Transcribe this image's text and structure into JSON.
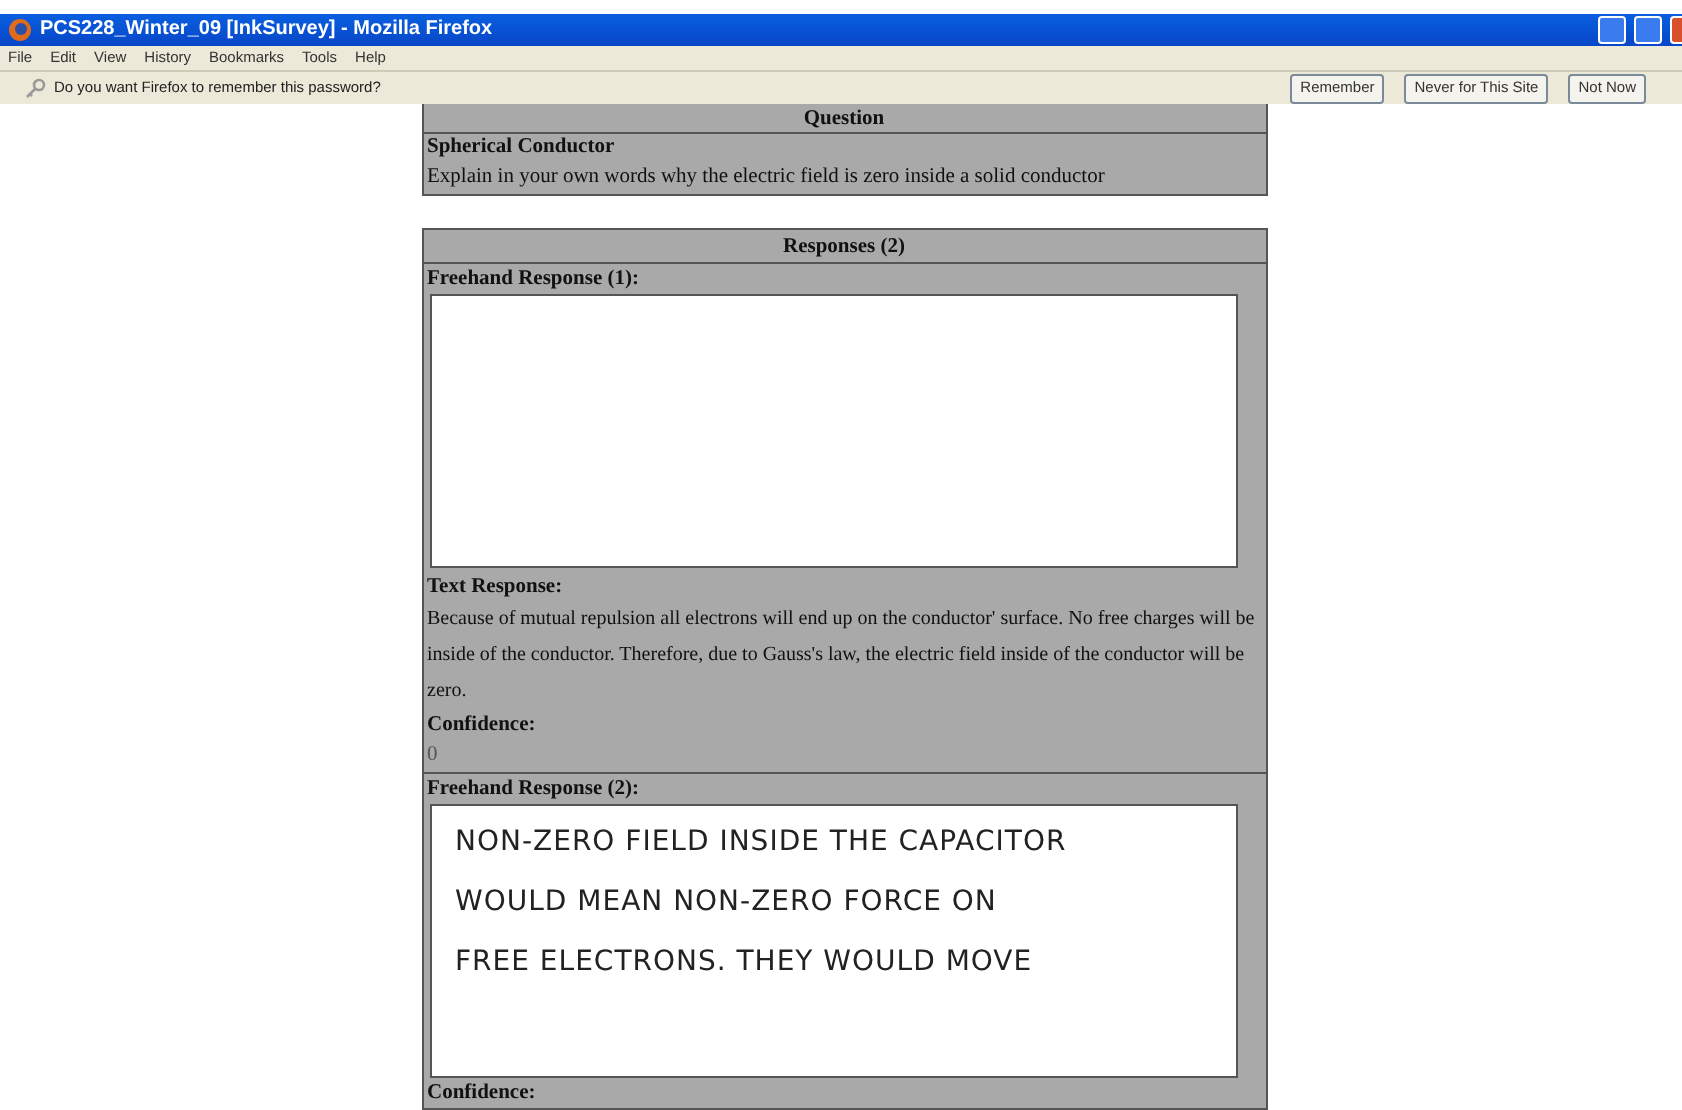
{
  "window": {
    "title": "PCS228_Winter_09 [InkSurvey] - Mozilla Firefox"
  },
  "menu": [
    "File",
    "Edit",
    "View",
    "History",
    "Bookmarks",
    "Tools",
    "Help"
  ],
  "notification": {
    "message": "Do you want Firefox to remember this password?",
    "buttons": [
      "Remember",
      "Never for This Site",
      "Not Now"
    ]
  },
  "question": {
    "header": "Question",
    "title": "Spherical Conductor",
    "text": "Explain in your own words why the electric field is zero inside a solid conductor"
  },
  "responses": {
    "header": "Responses (2)",
    "items": [
      {
        "freehand_label": "Freehand Response (1):",
        "text_label": "Text Response:",
        "text": "Because of mutual repulsion all electrons will end up on the conductor' surface. No free charges will be inside of the conductor. Therefore, due to Gauss's law, the electric field inside of the conductor will be zero.",
        "confidence_label": "Confidence:",
        "confidence": "0"
      },
      {
        "freehand_label": "Freehand Response (2):",
        "ink_lines": [
          "NON-ZERO FIELD INSIDE THE CAPACITOR",
          "WOULD MEAN NON-ZERO FORCE ON",
          "FREE ELECTRONS. THEY WOULD MOVE"
        ],
        "confidence_label": "Confidence:"
      }
    ]
  }
}
